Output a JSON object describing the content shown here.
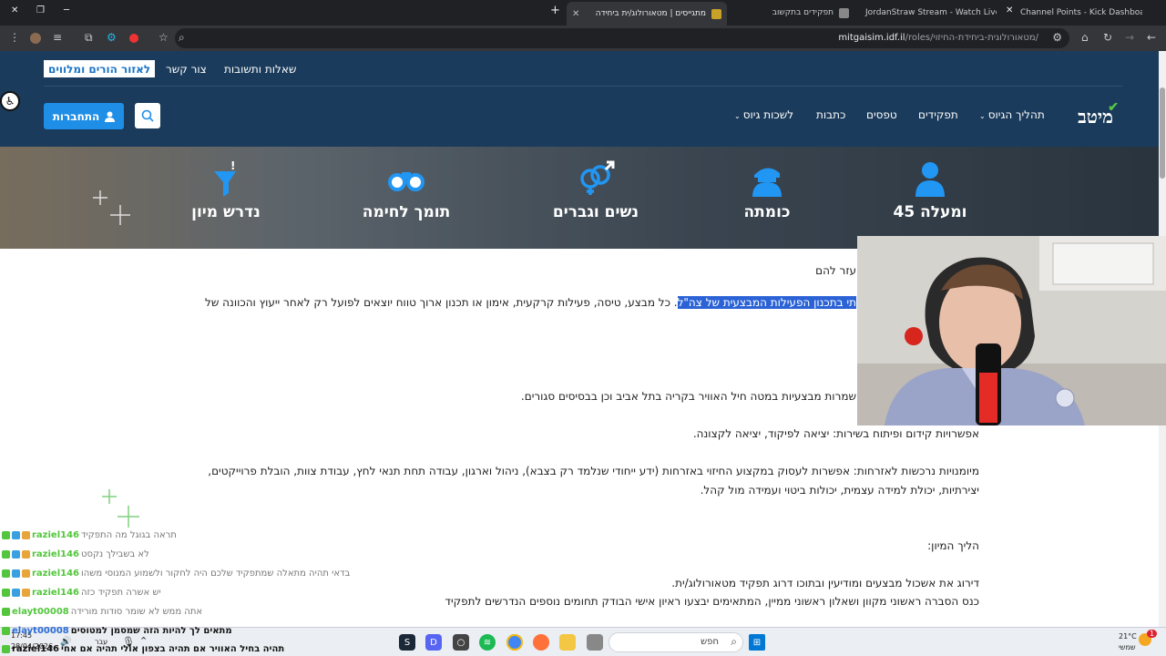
{
  "browser": {
    "tabs": [
      {
        "title": "Channel Points - Kick Dashboard",
        "favicon_color": "#53fc18"
      },
      {
        "title": "JordanStraw Stream - Watch Live",
        "favicon_color": "#53fc18"
      },
      {
        "title": "תפקידים בתקשוב",
        "favicon_color": "#888888"
      },
      {
        "title": "מתגייסים | מטאורולוג/ית ביחידה",
        "favicon_color": "#c9a227"
      }
    ],
    "new_tab": "+",
    "url_host": "mitgaisim.idf.il",
    "url_path": "/roles/מטאורולוגית-ביחידת-החיזוי/"
  },
  "site": {
    "top_links": [
      "שאלות ותשובות",
      "צור קשר"
    ],
    "parents_button": "לאזור הורים ומלווים",
    "logo": "מיטב",
    "nav": [
      "תהליך הגיוס",
      "תפקידים",
      "טפסים",
      "כתבות",
      "לשכות גיוס"
    ],
    "join_button": "התחברות"
  },
  "features": [
    {
      "label": "45 ומעלה",
      "icon": "soldier-icon"
    },
    {
      "label": "כומתה",
      "icon": "beret-icon"
    },
    {
      "label": "נשים וגברים",
      "icon": "gender-icon"
    },
    {
      "label": "תומך לחימה",
      "icon": "binoculars-icon"
    },
    {
      "label": "נדרש מיון",
      "icon": "funnel-icon"
    }
  ],
  "content": {
    "p1": "עזר להם",
    "p2_highlight": "תי בתכנון הפעילות המבצעית של צה\"ל",
    "p2_rest": ". כל מבצע, טיסה, פעילות קרקעית, אימון או תכנון ארוך טווח יוצאים לפועל רק לאחר ייעוץ והכוונה של",
    "p3": "שמרות מבצעיות במטה חיל האוויר בקריה בתל אביב וכן בבסיסים סגורים.",
    "p4": "אפשרויות קידום ופיתוח בשירות: יציאה לפיקוד, יציאה לקצונה.",
    "p5a": "מיומנויות נרכשות לאזרחות: אפשרות לעסוק במקצוע החיזוי באזרחות (ידע ייחודי שנלמד רק בצבא), ניהול וארגון, עבודה תחת תנאי לחץ, עבודת צוות, הובלת פרוייקטים,",
    "p5b": "יצירתיות, יכולת למידה עצמית, יכולות ביטוי ועמידה מול קהל.",
    "p6": "הליך המיון:",
    "p7": "דירוג את אשכול מבצעים ומודיעין ובתוכו דרוג תפקיד מטאורולוג/ית.",
    "p8": "כנס הסברה ראשוני מקוון ושאלון ראשוני ממיין, המתאימים יבצעו ראיון אישי הבודק תחומים נוספים הנדרשים לתפקיד"
  },
  "chat": [
    {
      "user": "raziel146",
      "msg": "תראה בגוגל מה התפקיד"
    },
    {
      "user": "raziel146",
      "msg": "לא בשבילך נקסט"
    },
    {
      "user": "raziel146",
      "msg": "בדאי תהיה מתאלה שמתפקיד שלכם היה לחקור ולשמוע המנוסי משהו"
    },
    {
      "user": "raziel146",
      "msg": "יש אשרה תפקיד כזה"
    },
    {
      "user": "elayt00008",
      "msg": "אתה ממש לא שומר סודות מורידה"
    },
    {
      "user": "elayt00008",
      "msg": "מתאים לך להיות הזה שמסמן למטוסים"
    },
    {
      "user": "raziel146",
      "msg": "תהיה בחיל האוויר אם תהיה בצפון אולי תהיה אם אחי"
    }
  ],
  "taskbar": {
    "search_placeholder": "חפש",
    "weather": "21°C",
    "weather_sub": "שמשי",
    "time": "17:45",
    "date": "28/04/2026",
    "lang": "עבר",
    "notif_count": "1"
  }
}
